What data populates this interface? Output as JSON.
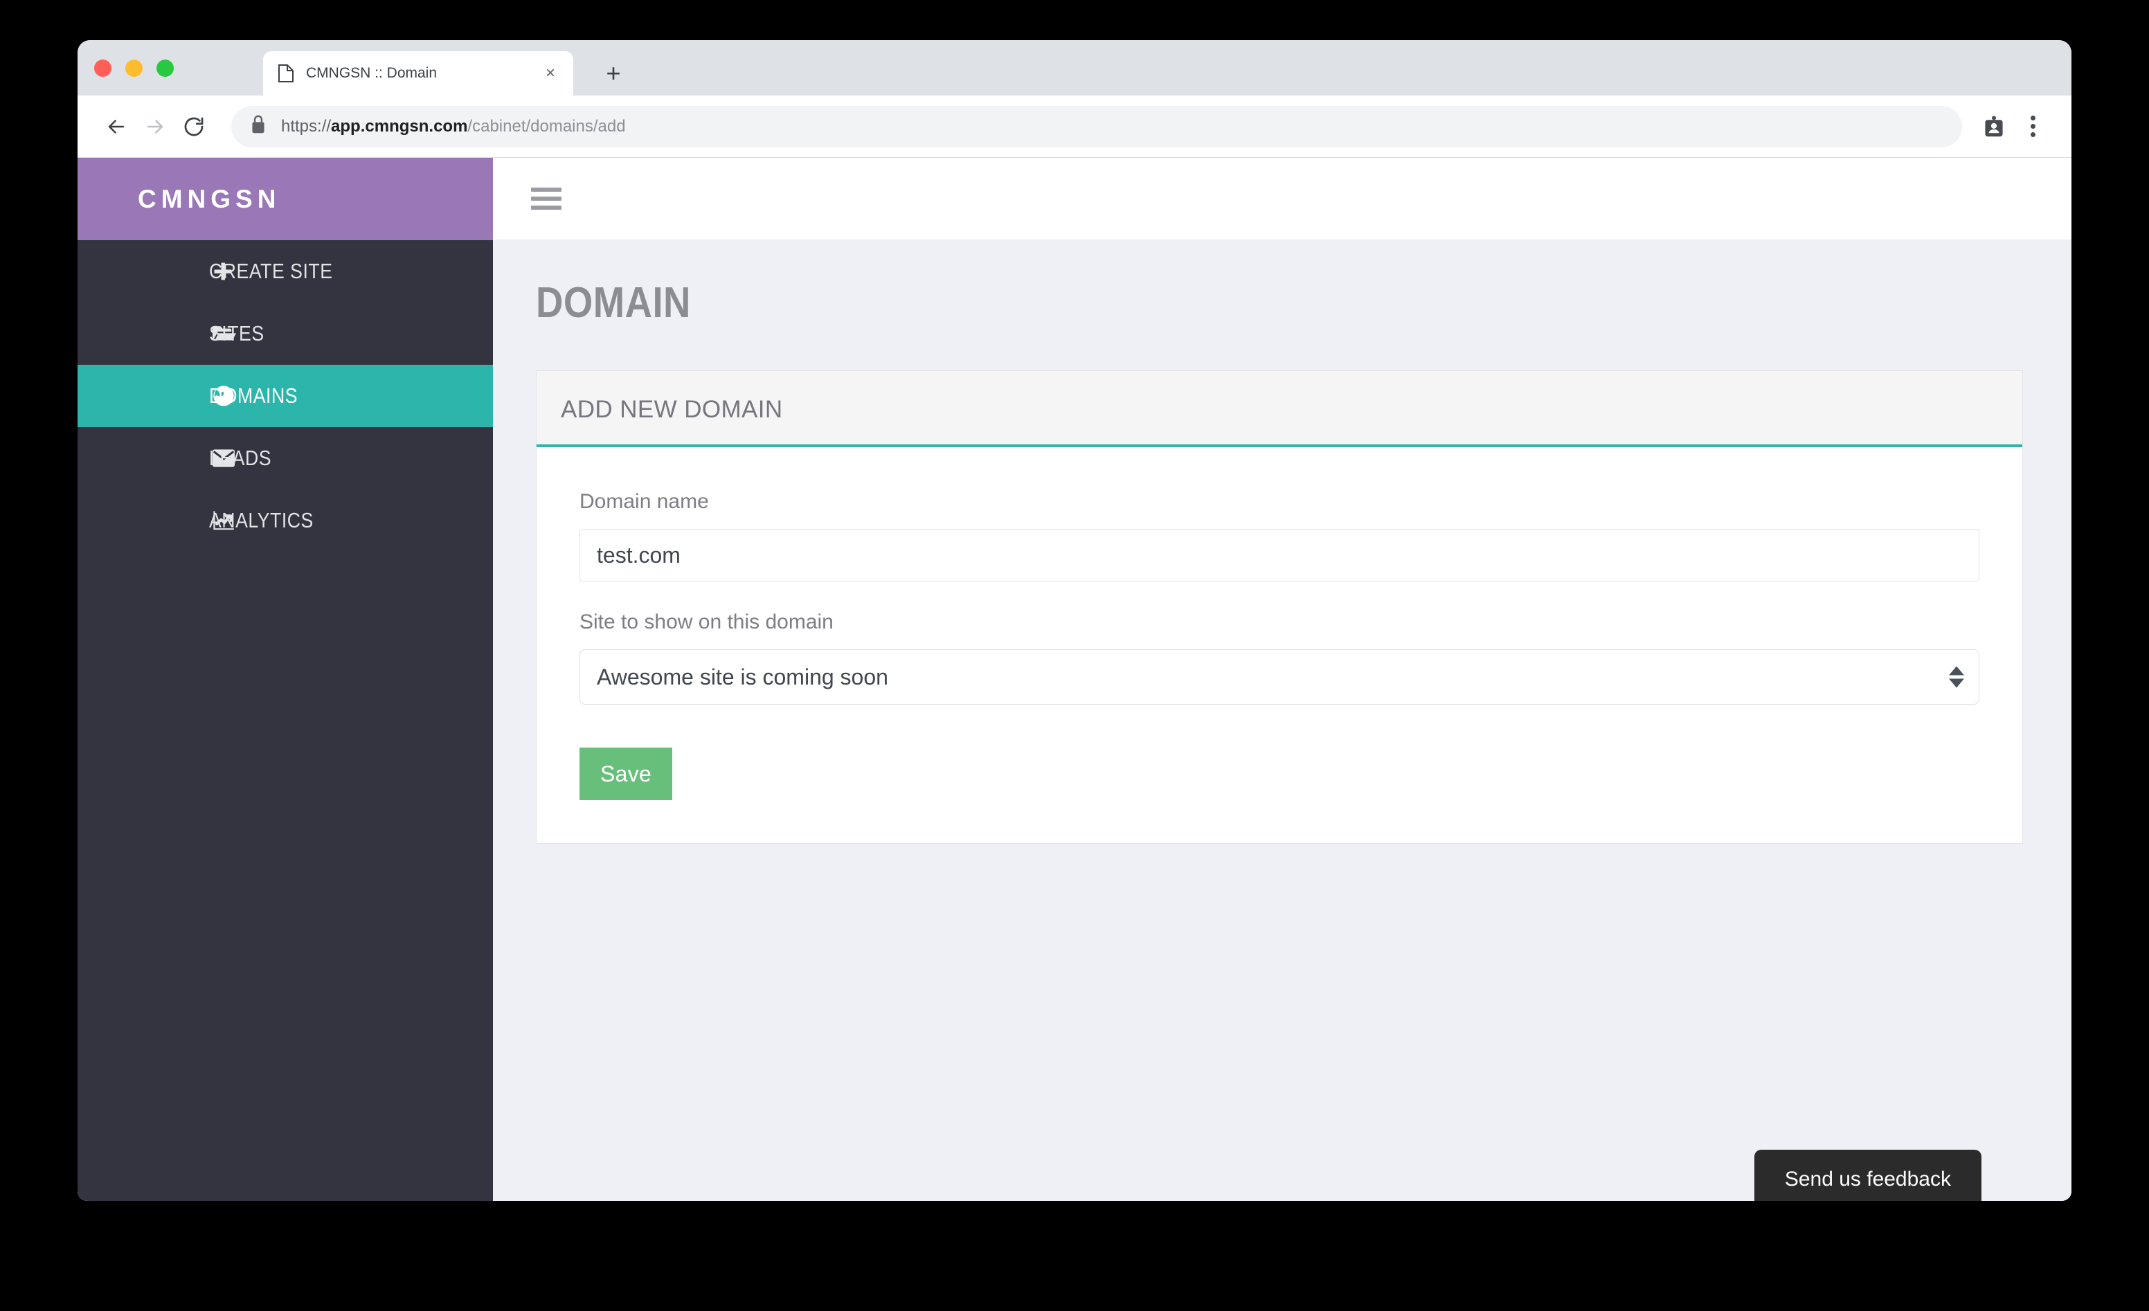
{
  "browser": {
    "tab": {
      "title": "CMNGSN :: Domain",
      "favicon": "document-icon",
      "close_label": "×"
    },
    "new_tab_label": "+",
    "nav": {
      "back_icon": "arrow-left-icon",
      "forward_icon": "arrow-right-icon",
      "reload_icon": "reload-icon"
    },
    "omnibox": {
      "lock_icon": "lock-icon",
      "url_scheme": "https://",
      "url_host": "app.cmngsn.com",
      "url_path": "/cabinet/domains/add",
      "full_url": "https://app.cmngsn.com/cabinet/domains/add"
    },
    "profile_icon": "contact-card-icon",
    "menu_icon": "kebab-menu-icon"
  },
  "sidebar": {
    "brand": "CMNGSN",
    "items": [
      {
        "label": "Create site",
        "icon": "plus-icon",
        "active": false
      },
      {
        "label": "Sites",
        "icon": "folder-open-icon",
        "active": false
      },
      {
        "label": "Domains",
        "icon": "globe-icon",
        "active": true
      },
      {
        "label": "Leads",
        "icon": "envelope-icon",
        "active": false
      },
      {
        "label": "Analytics",
        "icon": "line-chart-icon",
        "active": false
      }
    ]
  },
  "topbar": {
    "menu_toggle_icon": "hamburger-icon"
  },
  "main": {
    "page_title": "Domain",
    "panel": {
      "title": "Add new domain",
      "fields": {
        "domain_name": {
          "label": "Domain name",
          "value": "test.com",
          "placeholder": ""
        },
        "site_to_show": {
          "label": "Site to show on this domain",
          "value": "Awesome site is coming soon",
          "options": [
            "Awesome site is coming soon"
          ]
        }
      },
      "save_label": "Save"
    },
    "feedback_label": "Send us feedback"
  },
  "colors": {
    "brand_purple": "#9a78b8",
    "accent_teal": "#2cb5aa",
    "sidebar_dark": "#343440",
    "save_green": "#68bf7c",
    "page_bg": "#eff0f5",
    "panel_head_bg": "#f5f5f6",
    "feedback_bg": "#2b2b2b"
  }
}
